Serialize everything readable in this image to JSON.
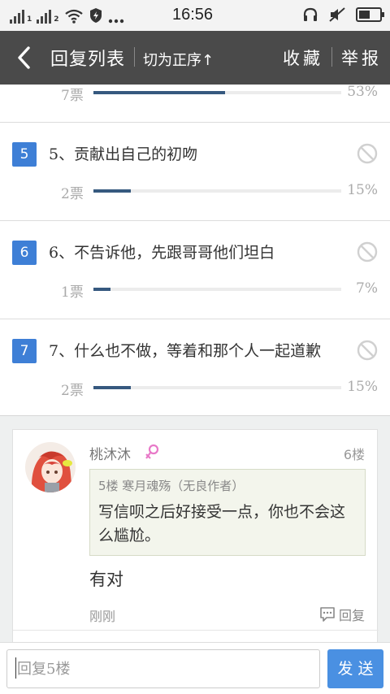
{
  "status_bar": {
    "time": "16:56",
    "sim1": "1",
    "sim2": "2",
    "icons": [
      "signal-icon",
      "signal-icon",
      "wifi-icon",
      "shield-icon",
      "more-dots-icon",
      "headset-icon",
      "mute-icon",
      "battery-icon"
    ]
  },
  "navbar": {
    "title": "回复列表",
    "sort_label": "切为正序↑",
    "favorite_label": "收藏",
    "report_label": "举报",
    "background": "#4a4a4a"
  },
  "poll": {
    "partial_option": {
      "votes": "7票",
      "percent": "53%",
      "share": 0.53
    },
    "options": [
      {
        "number": "5",
        "text": "5、贡献出自己的初吻",
        "votes": "2票",
        "percent": "15%",
        "share": 0.15
      },
      {
        "number": "6",
        "text": "6、不告诉他，先跟哥哥他们坦白",
        "votes": "1票",
        "percent": "7%",
        "share": 0.07
      },
      {
        "number": "7",
        "text": "7、什么也不做，等着和那个人一起道歉",
        "votes": "2票",
        "percent": "15%",
        "share": 0.15
      }
    ],
    "accent": "#3e7fd6",
    "bar_color": "#36597f"
  },
  "reply": {
    "username": "桃沐沐",
    "floor": "6楼",
    "quote_header": "5楼 寒月魂殇（无良作者）",
    "quote_text": "写信呗之后好接受一点，你也不会这么尴尬。",
    "content": "有对",
    "time": "刚刚",
    "reply_label": "回复"
  },
  "input": {
    "placeholder": "回复5楼",
    "send_label": "发送",
    "send_color": "#4a90e2"
  }
}
